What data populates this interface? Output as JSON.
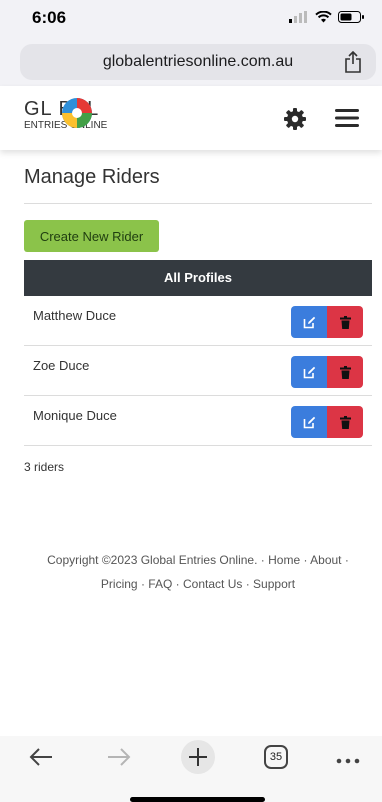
{
  "status": {
    "time": "6:06"
  },
  "browser": {
    "url": "globalentriesonline.com.au",
    "tab_count": "35"
  },
  "logo": {
    "top": "GL BAL",
    "bottom": "ENTRIES ONLINE"
  },
  "page": {
    "title": "Manage Riders",
    "create_button": "Create New Rider",
    "table_header": "All Profiles",
    "riders": [
      "Matthew Duce",
      "Zoe Duce",
      "Monique Duce"
    ],
    "count": "3 riders"
  },
  "footer": {
    "copyright": "Copyright ©2023 Global Entries Online.",
    "links": [
      "Home",
      "About",
      "Pricing",
      "FAQ",
      "Contact Us",
      "Support"
    ],
    "separator": "·"
  },
  "colors": {
    "create_green": "#8bc34a",
    "header_dark": "#343a40",
    "edit_blue": "#3b7ddd",
    "delete_red": "#dc3545"
  },
  "icons": {
    "status": [
      "signal-icon",
      "wifi-icon",
      "battery-icon"
    ],
    "row_actions": [
      "edit-icon",
      "trash-icon"
    ],
    "toolbar": [
      "back-arrow-icon",
      "forward-arrow-icon",
      "plus-icon",
      "tabs-icon",
      "more-icon"
    ]
  }
}
